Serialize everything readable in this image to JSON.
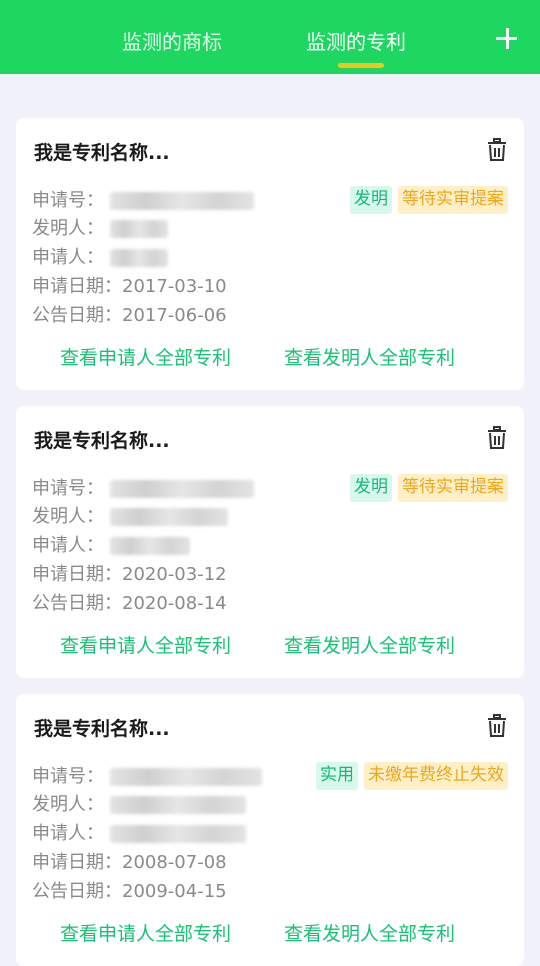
{
  "header": {
    "tabs": [
      {
        "label": "监测的商标",
        "active": false
      },
      {
        "label": "监测的专利",
        "active": true
      }
    ],
    "add_icon": "plus-icon"
  },
  "colors": {
    "brand": "#1ed760",
    "tab_indicator": "#f3c41b",
    "link": "#17c274",
    "type_badge_bg": "#d9f7ea",
    "status_badge_bg": "#fdf0c8"
  },
  "cards": [
    {
      "title": "我是专利名称...",
      "application_no_label": "申请号：",
      "inventor_label": "发明人：",
      "applicant_label": "申请人：",
      "application_date_label": "申请日期：",
      "application_date": "2017-03-10",
      "publication_date_label": "公告日期：",
      "publication_date": "2017-06-06",
      "type_badge": "发明",
      "status_badge": "等待实审提案",
      "link_applicant": "查看申请人全部专利",
      "link_inventor": "查看发明人全部专利"
    },
    {
      "title": "我是专利名称...",
      "application_no_label": "申请号：",
      "inventor_label": "发明人：",
      "applicant_label": "申请人：",
      "application_date_label": "申请日期：",
      "application_date": "2020-03-12",
      "publication_date_label": "公告日期：",
      "publication_date": "2020-08-14",
      "type_badge": "发明",
      "status_badge": "等待实审提案",
      "link_applicant": "查看申请人全部专利",
      "link_inventor": "查看发明人全部专利"
    },
    {
      "title": "我是专利名称...",
      "application_no_label": "申请号：",
      "inventor_label": "发明人：",
      "applicant_label": "申请人：",
      "application_date_label": "申请日期：",
      "application_date": "2008-07-08",
      "publication_date_label": "公告日期：",
      "publication_date": "2009-04-15",
      "type_badge": "实用",
      "status_badge": "未缴年费终止失效",
      "link_applicant": "查看申请人全部专利",
      "link_inventor": "查看发明人全部专利"
    }
  ]
}
